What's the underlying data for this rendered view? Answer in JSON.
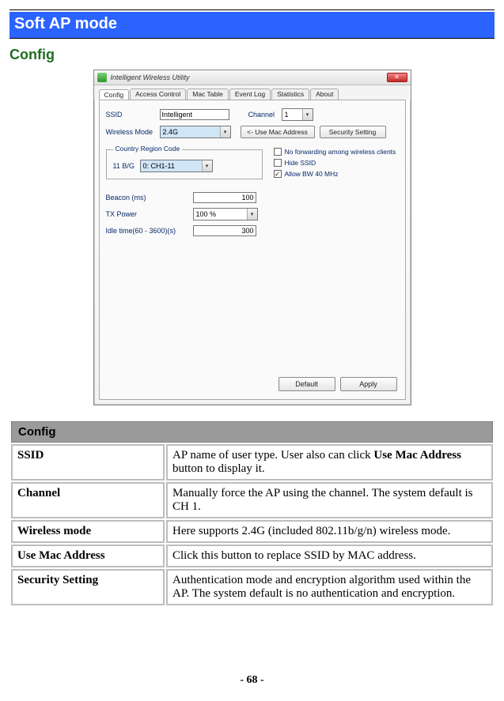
{
  "section_title": "Soft AP mode",
  "subheading": "Config",
  "app": {
    "title": "Intelligent Wireless Utility",
    "close_glyph": "✕",
    "tabs": [
      "Config",
      "Access Control",
      "Mac Table",
      "Event Log",
      "Statistics",
      "About"
    ],
    "fields": {
      "ssid_label": "SSID",
      "ssid_value": "Intelligent",
      "channel_label": "Channel",
      "channel_value": "1",
      "wireless_mode_label": "Wireless Mode",
      "wireless_mode_value": "2.4G",
      "use_mac_btn": "<- Use Mac Address",
      "security_btn": "Security Setting",
      "groupbox_title": "Country Region Code",
      "country_label": "11 B/G",
      "country_value": "0: CH1-11",
      "chk_no_forwarding": "No forwarding among wireless clients",
      "chk_hide_ssid": "Hide SSID",
      "chk_allow_bw": "Allow BW 40 MHz",
      "beacon_label": "Beacon (ms)",
      "beacon_value": "100",
      "txpower_label": "TX Power",
      "txpower_value": "100 %",
      "idle_label": "Idle time(60 - 3600)(s)",
      "idle_value": "300",
      "default_btn": "Default",
      "apply_btn": "Apply",
      "dd_arrow": "▾"
    }
  },
  "config_table": {
    "header": "Config",
    "rows": [
      {
        "key": "SSID",
        "desc_pre": "AP name of user type. User also can click ",
        "desc_bold": "Use Mac Address",
        "desc_post": " button to display it."
      },
      {
        "key": "Channel",
        "desc": "Manually force the AP using the channel. The system default is CH 1."
      },
      {
        "key": "Wireless mode",
        "desc": "Here supports 2.4G (included 802.11b/g/n) wireless mode."
      },
      {
        "key": "Use Mac Address",
        "desc": "Click this button to replace SSID by MAC address."
      },
      {
        "key": "Security Setting",
        "desc": "Authentication mode and encryption algorithm used within the AP. The system default is no authentication and encryption."
      }
    ]
  },
  "page_number": "- 68 -"
}
